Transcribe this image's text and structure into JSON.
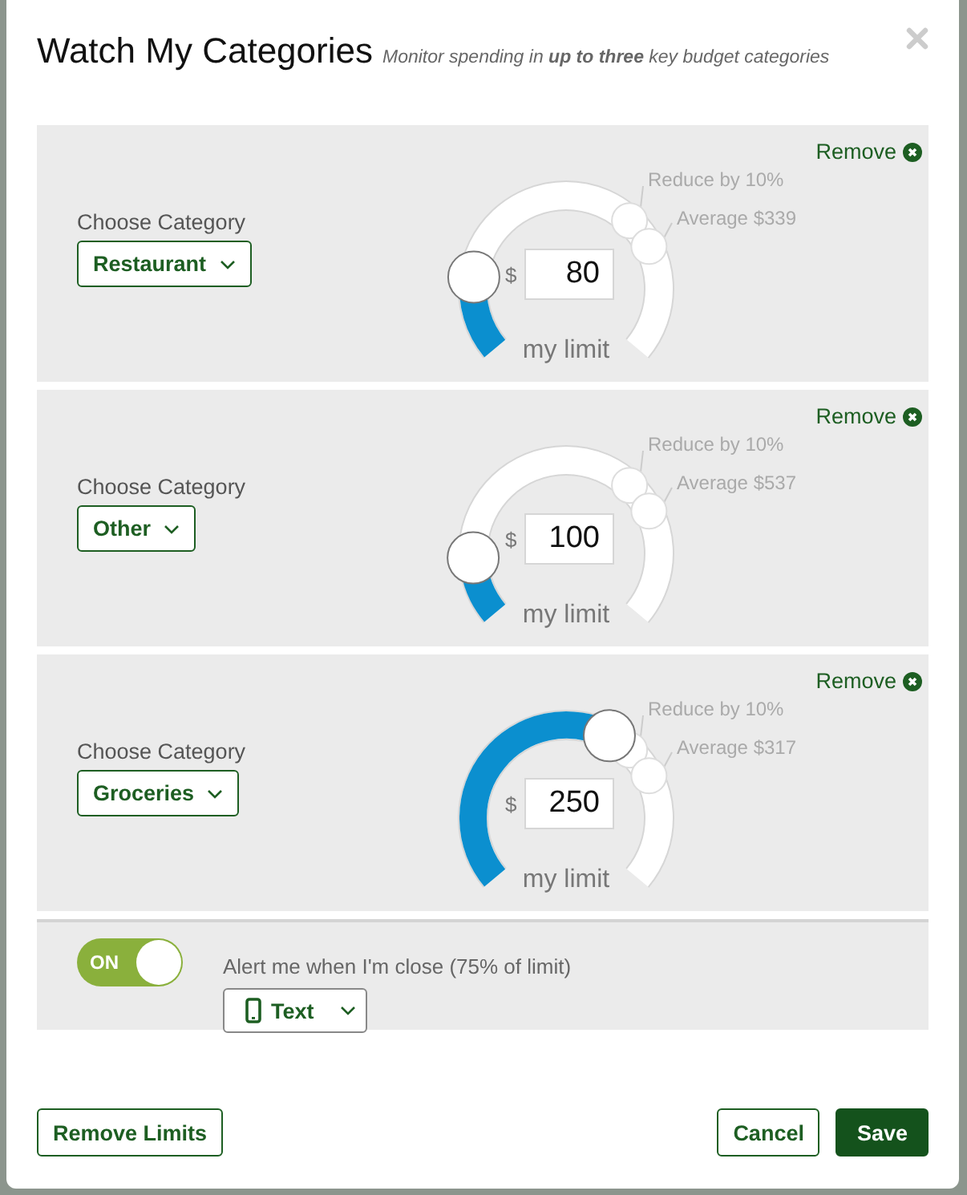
{
  "dialog": {
    "title": "Watch My Categories",
    "subtitle": "Monitor spending in **up to three** key budget categories"
  },
  "categories": [
    {
      "label": "Choose Category",
      "category": "Restaurant",
      "remove": "Remove",
      "reduce_label": "Reduce by 10%",
      "average_label": "Average $339",
      "currency": "$",
      "limit": "80",
      "limit_caption": "my limit"
    },
    {
      "label": "Choose Category",
      "category": "Other",
      "remove": "Remove",
      "reduce_label": "Reduce by 10%",
      "average_label": "Average $537",
      "currency": "$",
      "limit": "100",
      "limit_caption": "my limit"
    },
    {
      "label": "Choose Category",
      "category": "Groceries",
      "remove": "Remove",
      "reduce_label": "Reduce by 10%",
      "average_label": "Average $317",
      "currency": "$",
      "limit": "250",
      "limit_caption": "my limit"
    }
  ],
  "alert": {
    "toggle": {
      "label": "ON",
      "on": true
    },
    "text": "Alert me when I'm close (75% of limit)",
    "method": "Text"
  },
  "buttons": {
    "remove_limits": "Remove Limits",
    "cancel": "Cancel",
    "save": "Save"
  }
}
